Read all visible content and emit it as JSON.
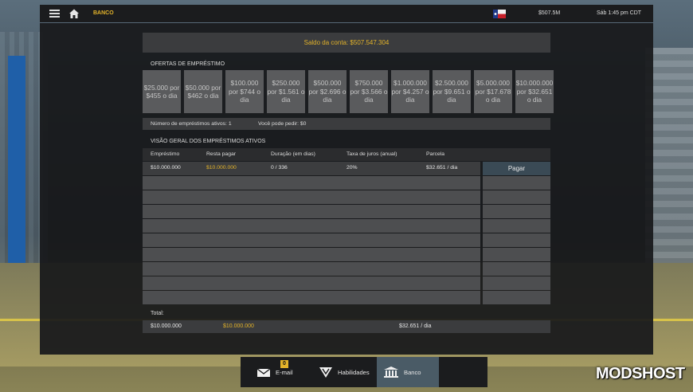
{
  "topbar": {
    "breadcrumb": "BANCO",
    "balance_short": "$507.5M",
    "datetime": "Sáb 1:45 pm CDT"
  },
  "balance": {
    "text": "Saldo da conta: $507.547.304"
  },
  "offers": {
    "title": "OFERTAS DE EMPRÉSTIMO",
    "items": [
      "$25.000 por $455 o dia",
      "$50.000 por $462 o dia",
      "$100.000 por $744 o dia",
      "$250.000 por $1.561 o dia",
      "$500.000 por $2.696 o dia",
      "$750.000 por $3.566 o dia",
      "$1.000.000 por $4.257 o dia",
      "$2.500.000 por $9.651 o dia",
      "$5.000.000 por $17.678 o dia",
      "$10.000.000 por $32.651 o dia"
    ]
  },
  "info": {
    "active_loans": "Número de empréstimos ativos: 1",
    "can_borrow": "Você pode pedir: $0"
  },
  "overview": {
    "title": "VISÃO GERAL DOS EMPRÉSTIMOS ATIVOS",
    "headers": [
      "Empréstimo",
      "Resta pagar",
      "Duração (em dias)",
      "Taxa de juros (anual)",
      "Parcela"
    ],
    "active_row": {
      "loan": "$10.000.000",
      "remaining": "$10.000.000",
      "duration": "0 / 336",
      "rate": "20%",
      "installment": "$32.651 / dia",
      "action": "Pagar"
    }
  },
  "totals": {
    "label": "Total:",
    "loan": "$10.000.000",
    "remaining": "$10.000.000",
    "installment": "$32.651 / dia"
  },
  "nav": {
    "email": {
      "label": "E-mail",
      "badge": "0"
    },
    "skills": {
      "label": "Habilidades"
    },
    "bank": {
      "label": "Banco"
    }
  },
  "watermark": "MODSHOST",
  "colors": {
    "accent": "#e3b32a",
    "active_nav": "#4a5b66",
    "pay_button": "#3a4a55"
  }
}
